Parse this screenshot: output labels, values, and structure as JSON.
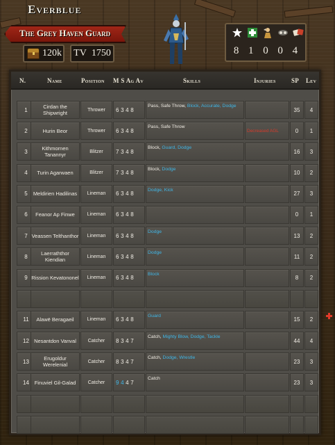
{
  "team": {
    "name": "Everblue",
    "roster_name": "The Grey Haven Guard",
    "treasury": "120k",
    "tv_label": "TV",
    "tv_value": "1750"
  },
  "team_stats": {
    "icons": [
      "star-icon",
      "apothecary-icon",
      "cheerleader-icon",
      "assistant-coach-icon",
      "reroll-icon"
    ],
    "values": [
      "8",
      "1",
      "0",
      "0",
      "4"
    ]
  },
  "table": {
    "headers": {
      "n": "N.",
      "name": "Name",
      "position": "Position",
      "stats": "M S Ag Av",
      "skills": "Skills",
      "injuries": "Injuries",
      "sp": "SP",
      "lev": "Lev"
    },
    "rows": [
      {
        "n": "1",
        "name": "Cirdan the Shipwright",
        "position": "Thrower",
        "stats": "6348",
        "skills_base": "Pass, Safe Throw, ",
        "skills_new": "Block, Accurate, Dodge",
        "injuries": "",
        "sp": "35",
        "lev": "4"
      },
      {
        "n": "2",
        "name": "Hurin Beor",
        "position": "Thrower",
        "stats": "6348",
        "skills_base": "Pass, Safe Throw",
        "skills_new": "",
        "injuries": "Decreased AGL",
        "sp": "0",
        "lev": "1"
      },
      {
        "n": "3",
        "name": "Kithmornen Tanannyr",
        "position": "Blitzer",
        "stats": "7348",
        "skills_base": "Block, ",
        "skills_new": "Guard, Dodge",
        "injuries": "",
        "sp": "16",
        "lev": "3"
      },
      {
        "n": "4",
        "name": "Turin Agarwaen",
        "position": "Blitzer",
        "stats": "7348",
        "skills_base": "Block, ",
        "skills_new": "Dodge",
        "injuries": "",
        "sp": "10",
        "lev": "2"
      },
      {
        "n": "5",
        "name": "Meldirien Hadilinas",
        "position": "Lineman",
        "stats": "6348",
        "skills_base": "",
        "skills_new": "Dodge, Kick",
        "injuries": "",
        "sp": "27",
        "lev": "3"
      },
      {
        "n": "6",
        "name": "Feanor Ap Finwe",
        "position": "Lineman",
        "stats": "6348",
        "skills_base": "",
        "skills_new": "",
        "injuries": "",
        "sp": "0",
        "lev": "1"
      },
      {
        "n": "7",
        "name": "Veassen Telthanthor",
        "position": "Lineman",
        "stats": "6348",
        "skills_base": "",
        "skills_new": "Dodge",
        "injuries": "",
        "sp": "13",
        "lev": "2"
      },
      {
        "n": "8",
        "name": "Laerraththor Kiendian",
        "position": "Lineman",
        "stats": "6348",
        "skills_base": "",
        "skills_new": "Dodge",
        "injuries": "",
        "sp": "11",
        "lev": "2"
      },
      {
        "n": "9",
        "name": "Rission Kevatononel",
        "position": "Lineman",
        "stats": "6348",
        "skills_base": "",
        "skills_new": "Block",
        "injuries": "",
        "sp": "8",
        "lev": "2"
      },
      {
        "n": "",
        "name": "",
        "position": "",
        "stats": "",
        "skills_base": "",
        "skills_new": "",
        "injuries": "",
        "sp": "",
        "lev": ""
      },
      {
        "n": "11",
        "name": "Alawë Beragaeil",
        "position": "Lineman",
        "stats": "6348",
        "skills_base": "",
        "skills_new": "Guard",
        "injuries": "",
        "sp": "15",
        "lev": "2"
      },
      {
        "n": "12",
        "name": "Nesantdon Vanval",
        "position": "Catcher",
        "stats": "8347",
        "skills_base": "Catch, ",
        "skills_new": "Mighty Blow, Dodge, Tackle",
        "injuries": "",
        "sp": "44",
        "lev": "4"
      },
      {
        "n": "13",
        "name": "Erugoldur Werelenial",
        "position": "Catcher",
        "stats": "8347",
        "skills_base": "Catch, ",
        "skills_new": "Dodge, Wrestle",
        "injuries": "",
        "sp": "23",
        "lev": "3"
      },
      {
        "n": "14",
        "name": "Finuviel Gil-Galad",
        "position": "Catcher",
        "stats": "9447",
        "skills_base": "Catch",
        "skills_new": "",
        "injuries": "",
        "sp": "23",
        "lev": "3"
      },
      {
        "n": "",
        "name": "",
        "position": "",
        "stats": "",
        "skills_base": "",
        "skills_new": "",
        "injuries": "",
        "sp": "",
        "lev": ""
      },
      {
        "n": "",
        "name": "",
        "position": "",
        "stats": "",
        "skills_base": "",
        "skills_new": "",
        "injuries": "",
        "sp": "",
        "lev": ""
      }
    ]
  },
  "colors": {
    "banner": "#a02617",
    "skill_gained": "#3fb7e8",
    "injury": "#d63a2a",
    "improved_stat": "#3fb7e8"
  }
}
